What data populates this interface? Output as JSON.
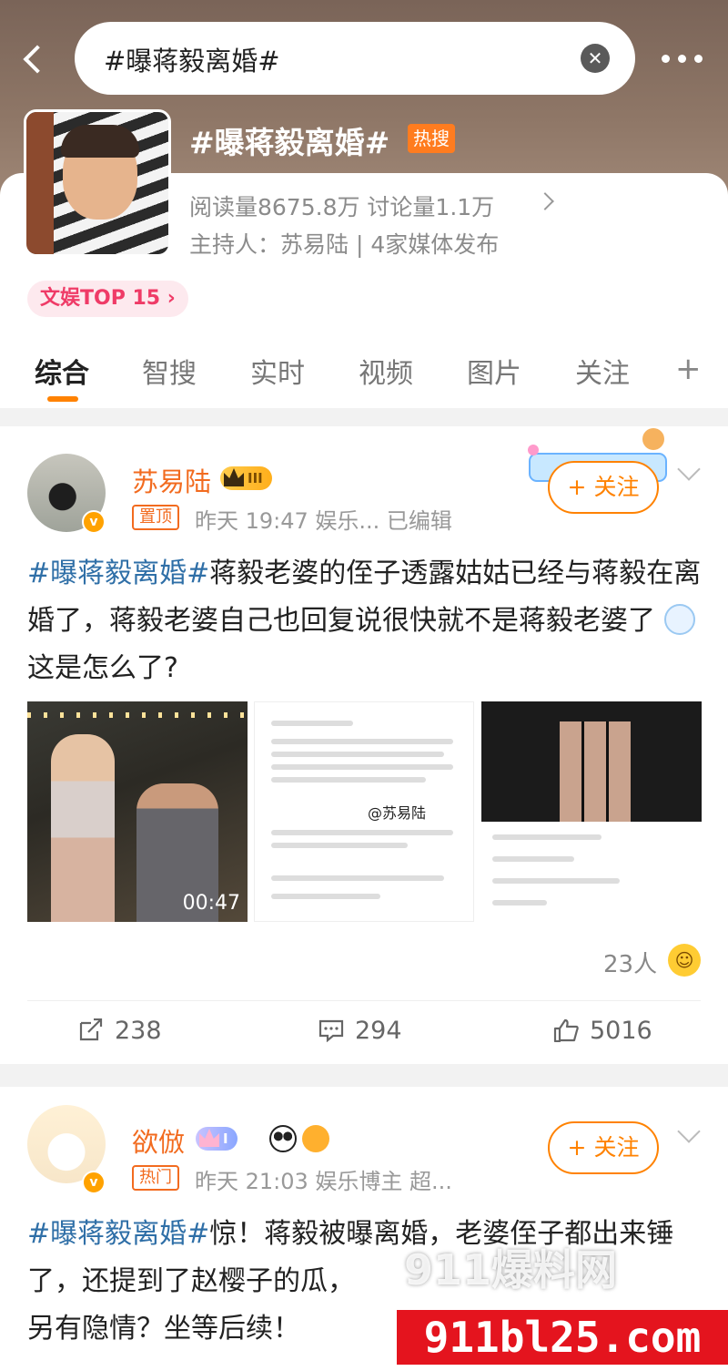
{
  "search": {
    "query": "#曝蒋毅离婚#"
  },
  "topic": {
    "title": "#曝蒋毅离婚#",
    "hot_badge": "热搜",
    "stats": "阅读量8675.8万  讨论量1.1万",
    "host": "主持人：苏易陆 | 4家媒体发布",
    "rank_badge": "文娱TOP 15 ›"
  },
  "tabs": [
    {
      "label": "综合",
      "active": true
    },
    {
      "label": "智搜"
    },
    {
      "label": "实时"
    },
    {
      "label": "视频"
    },
    {
      "label": "图片"
    },
    {
      "label": "关注"
    }
  ],
  "tab_plus": "+",
  "posts": [
    {
      "user_name": "苏易陆",
      "level": "III",
      "tag": "置顶",
      "meta": "昨天 19:47  娱乐...  已编辑",
      "follow_label": "+ 关注",
      "hashtag": "#曝蒋毅离婚#",
      "text": "蒋毅老婆的侄子透露姑姑已经与蒋毅在离婚了，蒋毅老婆自己也回复说很快就不是蒋毅老婆了",
      "text_tail": "这是怎么了?",
      "video_duration": "00:47",
      "image2_watermark": "@苏易陆",
      "reactions": "23人",
      "actions": {
        "repost": "238",
        "comment": "294",
        "like": "5016"
      }
    },
    {
      "user_name": "欲倣",
      "level": "I",
      "tag": "热门",
      "meta": "昨天 21:03  娱乐博主 超...",
      "follow_label": "+ 关注",
      "hashtag": "#曝蒋毅离婚#",
      "text": "惊！蒋毅被曝离婚，老婆侄子都出来锤了，还提到了赵樱子的瓜，",
      "text_tail": "另有隐情？坐等后续！"
    }
  ],
  "watermark": {
    "top": "911爆料网",
    "bottom": "911bl25.com"
  },
  "colors": {
    "accent": "#ff8200",
    "hashtag": "#2f6fa7",
    "username": "#f26b1f"
  },
  "icons": [
    "back-icon",
    "clear-icon",
    "more-icon",
    "repost-icon",
    "comment-icon",
    "like-icon",
    "chevron-down-icon"
  ]
}
